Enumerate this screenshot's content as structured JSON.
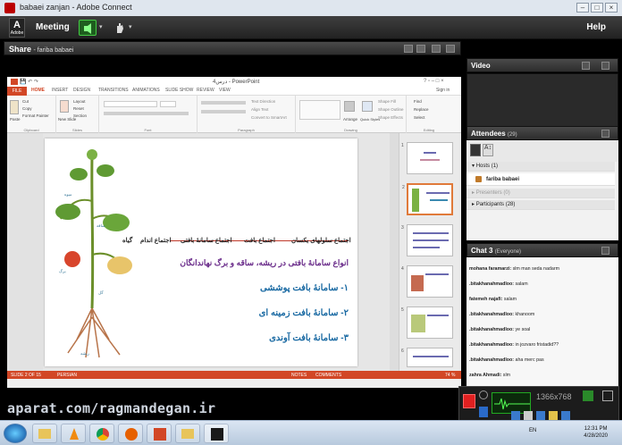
{
  "window": {
    "title": "babaei zanjan - Adobe Connect"
  },
  "menubar": {
    "meeting": "Meeting",
    "help": "Help",
    "logo_letter": "A",
    "logo_sub": "Adobe"
  },
  "share": {
    "title": "Share",
    "presenter": "- fariba babaei"
  },
  "video": {
    "title": "Video"
  },
  "attendees": {
    "title": "Attendees",
    "count": "(29)",
    "hosts": "Hosts (1)",
    "host_name": "fariba babaei",
    "presenters": "Presenters (0)",
    "participants": "Participants (28)"
  },
  "chat": {
    "title": "Chat 3",
    "scope": "(Everyone)",
    "messages": [
      {
        "name": "mohana faramarzi:",
        "text": "slm man seda nadarm"
      },
      {
        "name": ".bitakhanahmadloo:",
        "text": "salam"
      },
      {
        "name": "fatemeh najafi:",
        "text": "salam"
      },
      {
        "name": ".bitakhanahmadloo:",
        "text": "khanoom"
      },
      {
        "name": ".bitakhanahmadloo:",
        "text": "ye soal"
      },
      {
        "name": ".bitakhanahmadloo:",
        "text": "in jozvaro fristadid??"
      },
      {
        "name": ".bitakhanahmadloo:",
        "text": "aha merc pas"
      },
      {
        "name": "zahra Ahmadi:",
        "text": "slm"
      }
    ]
  },
  "powerpoint": {
    "title_bar": "درس4 - PowerPoint",
    "sign_in": "Sign in",
    "tabs": [
      "FILE",
      "HOME",
      "INSERT",
      "DESIGN",
      "TRANSITIONS",
      "ANIMATIONS",
      "SLIDE SHOW",
      "REVIEW",
      "VIEW"
    ],
    "groups": [
      "Clipboard",
      "Slides",
      "Font",
      "Paragraph",
      "Drawing",
      "Editing"
    ],
    "clipboard_items": [
      "Cut",
      "Copy",
      "Format Painter",
      "Paste"
    ],
    "slides_items": [
      "Layout",
      "Reset",
      "Section",
      "New Slide"
    ],
    "para_items": [
      "Text Direction",
      "Align Text",
      "Convert to SmartArt"
    ],
    "drawing_items": [
      "Shape Fill",
      "Shape Outline",
      "Shape Effects",
      "Arrange",
      "Quick Styles"
    ],
    "editing_items": [
      "Find",
      "Replace",
      "Select"
    ],
    "status_left": "SLIDE 2 OF 15",
    "status_lang": "PERSIAN",
    "status_notes": "NOTES",
    "status_comments": "COMMENTS",
    "zoom": "74 %",
    "thumb_numbers": [
      "1",
      "2",
      "3",
      "4",
      "5",
      "6"
    ]
  },
  "slide": {
    "hierarchy": [
      "اجتماع سلولهای یکسان",
      "اجتماع بافت",
      "اجتماع سامانهٔ بافتی",
      "اجتماع اندام",
      "گیاه"
    ],
    "subtitle": "انواع سامانهٔ بافتی در ریشه، ساقه و برگ نهاندانگان",
    "items": [
      "۱- سامانهٔ بافت پوششی",
      "۲- سامانهٔ بافت زمینه ای",
      "۳- سامانهٔ بافت آوندی"
    ],
    "plant_labels": [
      "میوه",
      "ساقه",
      "برگ",
      "گل",
      "ریشه"
    ]
  },
  "recorder": {
    "time": "1366x768"
  },
  "watermark": "aparat.com/ragmandegan.ir",
  "taskbar": {
    "lang": "EN",
    "time": "12:31 PM",
    "date": "4/28/2020"
  },
  "colors": {
    "ppt_accent": "#d24726",
    "slide_blue": "#1a6aa3",
    "slide_purple": "#6a2c8a"
  }
}
